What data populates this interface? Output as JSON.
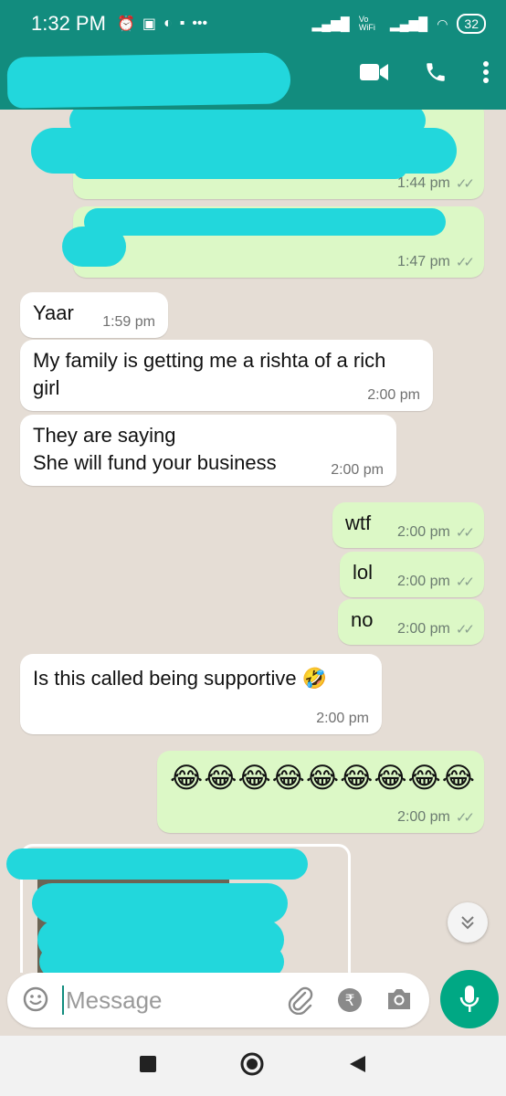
{
  "status_bar": {
    "time": "1:32 PM",
    "battery": "32",
    "vowifi": "Vo WiFi"
  },
  "header": {
    "contact_name_redacted": true
  },
  "messages": [
    {
      "dir": "out",
      "text": "",
      "time": "1:44 pm",
      "ticks": "✓✓",
      "redacted": true
    },
    {
      "dir": "out",
      "text": "",
      "time": "1:47 pm",
      "ticks": "✓✓",
      "redacted": true
    },
    {
      "dir": "in",
      "text": "Yaar",
      "time": "1:59 pm"
    },
    {
      "dir": "in",
      "text": "My family is getting me a rishta of a rich girl",
      "time": "2:00 pm"
    },
    {
      "dir": "in",
      "text": "They are saying\nShe will fund your business",
      "time": "2:00 pm"
    },
    {
      "dir": "out",
      "text": "wtf",
      "time": "2:00 pm",
      "ticks": "✓✓"
    },
    {
      "dir": "out",
      "text": "lol",
      "time": "2:00 pm",
      "ticks": "✓✓"
    },
    {
      "dir": "out",
      "text": "no",
      "time": "2:00 pm",
      "ticks": "✓✓"
    },
    {
      "dir": "in",
      "text": "Is this called being supportive 🤣",
      "time": "2:00 pm"
    },
    {
      "dir": "out",
      "text": "😂😂😂😂😂😂😂😂😂",
      "time": "2:00 pm",
      "ticks": "✓✓"
    },
    {
      "dir": "in",
      "text": "",
      "time": "",
      "redacted": true,
      "media": true
    }
  ],
  "input": {
    "placeholder": "Message"
  },
  "colors": {
    "primary": "#128c7e",
    "outgoing": "#dcf8c6",
    "incoming": "#ffffff",
    "background": "#e5ddd5",
    "mic": "#00a884",
    "redaction": "#22d7dc"
  }
}
